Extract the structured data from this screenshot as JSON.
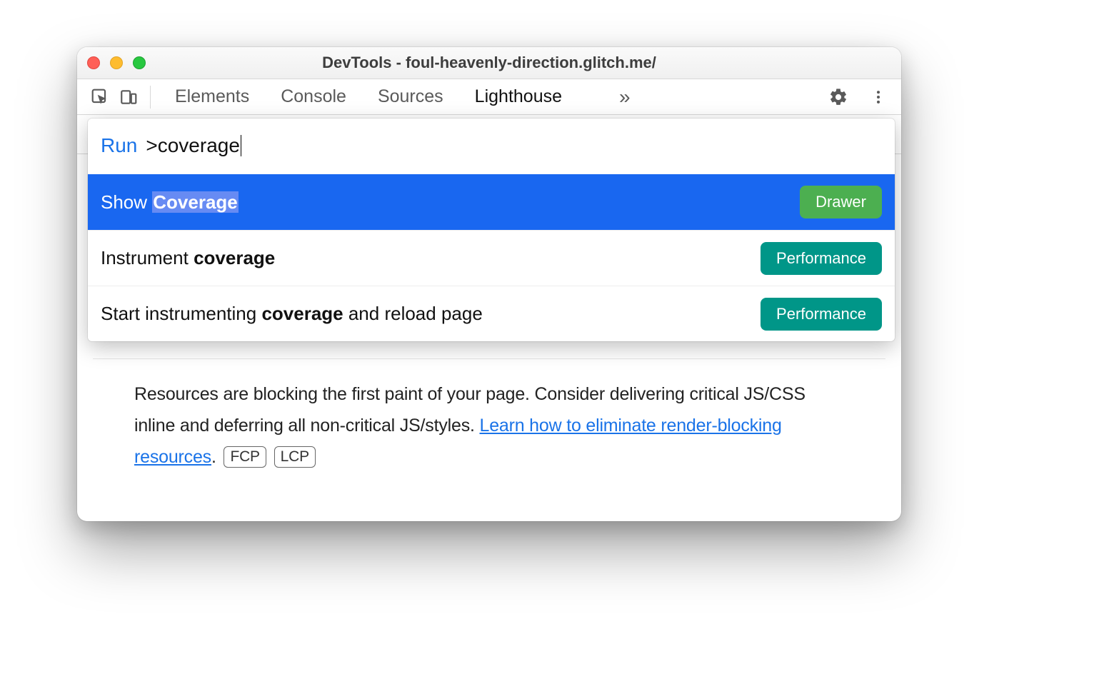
{
  "window": {
    "title": "DevTools - foul-heavenly-direction.glitch.me/"
  },
  "tabs": {
    "elements": "Elements",
    "console": "Console",
    "sources": "Sources",
    "lighthouse": "Lighthouse",
    "more": "»"
  },
  "command": {
    "run_label": "Run",
    "prefix": ">",
    "query": "coverage",
    "results": [
      {
        "pre": "Show ",
        "match": "Coverage",
        "post": "",
        "badge": "Drawer",
        "badge_class": "green1",
        "selected": true,
        "highlight_match": true
      },
      {
        "pre": "Instrument ",
        "match": "coverage",
        "post": "",
        "badge": "Performance",
        "badge_class": "green2",
        "selected": false,
        "highlight_match": false
      },
      {
        "pre": "Start instrumenting ",
        "match": "coverage",
        "post": " and reload page",
        "badge": "Performance",
        "badge_class": "green2",
        "selected": false,
        "highlight_match": false
      }
    ]
  },
  "advice": {
    "text_before_link": "Resources are blocking the first paint of your page. Consider delivering critical JS/CSS inline and deferring all non-critical JS/styles. ",
    "link_text": "Learn how to eliminate render-blocking resources",
    "text_after_link": ". ",
    "metric1": "FCP",
    "metric2": "LCP"
  }
}
